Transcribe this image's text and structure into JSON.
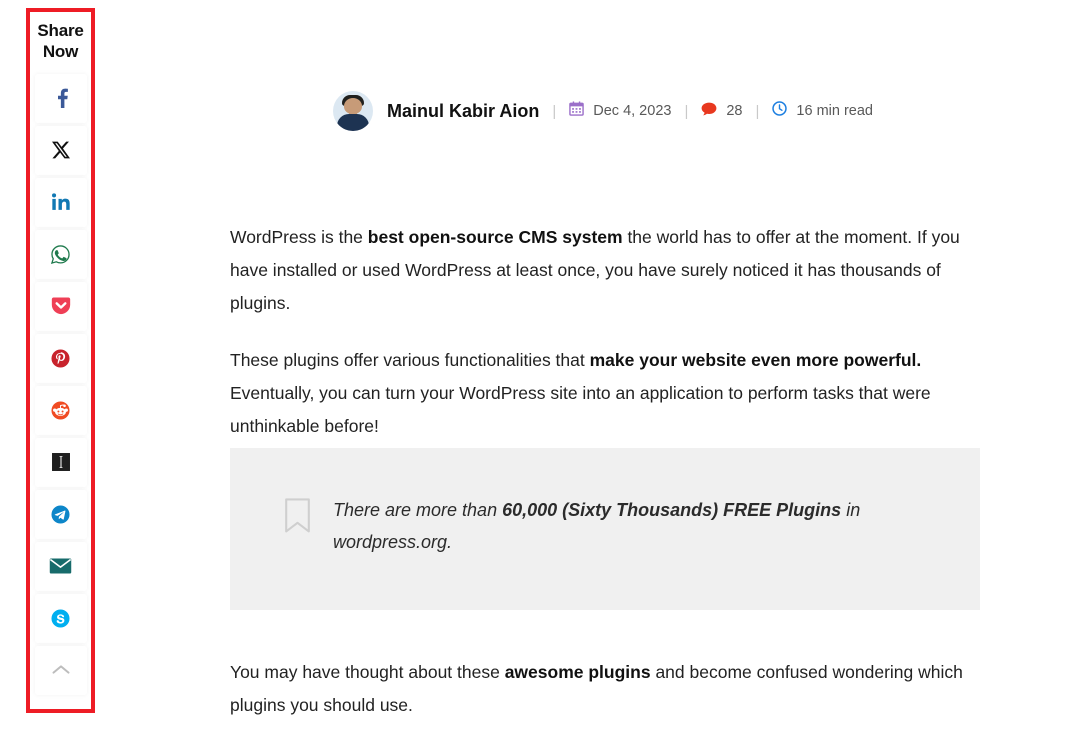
{
  "share": {
    "title": "Share Now",
    "title_line1": "Share",
    "title_line2": "Now",
    "items": [
      {
        "name": "facebook",
        "label": "Share on Facebook",
        "color": "#3b5998"
      },
      {
        "name": "x-twitter",
        "label": "Share on X",
        "color": "#111111"
      },
      {
        "name": "linkedin",
        "label": "Share on LinkedIn",
        "color": "#1178b3"
      },
      {
        "name": "whatsapp",
        "label": "Share on WhatsApp",
        "color": "#1f7a4d"
      },
      {
        "name": "pocket",
        "label": "Save to Pocket",
        "color": "#ef3f56"
      },
      {
        "name": "pinterest",
        "label": "Pin on Pinterest",
        "color": "#c8232c"
      },
      {
        "name": "reddit",
        "label": "Share on Reddit",
        "color": "#f04b23"
      },
      {
        "name": "instapaper",
        "label": "Save to Instapaper",
        "color": "#1f1f1f"
      },
      {
        "name": "telegram",
        "label": "Share on Telegram",
        "color": "#0d86c9"
      },
      {
        "name": "email",
        "label": "Share by Email",
        "color": "#176b6b"
      },
      {
        "name": "skype",
        "label": "Share on Skype",
        "color": "#00aff0"
      },
      {
        "name": "collapse",
        "label": "Collapse share bar",
        "color": "#bdbdbd"
      }
    ],
    "border_color": "#ee1c25"
  },
  "post_meta": {
    "author": "Mainul Kabir Aion",
    "date": "Dec 4, 2023",
    "comments": "28",
    "read_time": "16 min read",
    "separator": "|",
    "icon_colors": {
      "calendar": "#9b6fc9",
      "comment": "#e8381f",
      "clock": "#1d7fe0"
    }
  },
  "content": {
    "paragraph_1": {
      "part_1": "WordPress is the ",
      "bold_1": "best open-source CMS system",
      "part_2": " the world has to offer at the moment. If you have installed or used WordPress at least once, you have surely noticed it has thousands of plugins."
    },
    "paragraph_2": {
      "part_1": "These plugins offer various functionalities that ",
      "bold_1": "make your website even more powerful.",
      "part_2": " Eventually, you can turn your WordPress site into an application to perform tasks that were unthinkable before!"
    },
    "callout": {
      "part_1": "There are more than ",
      "bold_1": "60,000 (Sixty Thousands) FREE Plugins",
      "part_2": " in wordpress.org.",
      "background": "#f0f0f0"
    },
    "paragraph_3": {
      "part_1": "You may have thought about these ",
      "bold_1": "awesome plugins",
      "part_2": " and become confused wondering which plugins you should use."
    }
  }
}
